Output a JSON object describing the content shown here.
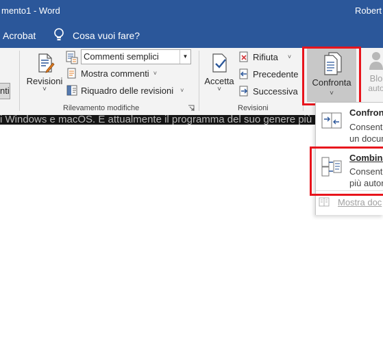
{
  "titlebar": {
    "title": "mento1 - Word",
    "user": "Robert"
  },
  "menubar": {
    "acrobat": "Acrobat",
    "tell_me": "Cosa vuoi fare?"
  },
  "ribbon": {
    "cut_button_label": "nti",
    "revisioni": {
      "label": "Revisioni",
      "caret": "˅"
    },
    "markup_combo": {
      "value": "Commenti semplici"
    },
    "mostra_commenti": {
      "label": "Mostra commenti",
      "caret": "˅"
    },
    "riquadro": {
      "label": "Riquadro delle revisioni",
      "caret": "˅"
    },
    "group_tracking_label": "Rilevamento modifiche",
    "accetta": {
      "label": "Accetta",
      "caret": "˅"
    },
    "rifiuta": {
      "label": "Rifiuta",
      "caret": "˅"
    },
    "precedente": {
      "label": "Precedente"
    },
    "successiva": {
      "label": "Successiva"
    },
    "group_revisioni_label": "Revisioni",
    "confronta": {
      "label": "Confronta",
      "caret": "˅"
    },
    "blocca": {
      "label_line1": "Blo",
      "label_line2": "auto"
    }
  },
  "document": {
    "visible_text": "i Windows e macOS. È attualmente il programma del suo genere più"
  },
  "dropdown": {
    "confronta": {
      "title": "Confronta",
      "desc_line1": "Consente",
      "desc_line2": "un docum"
    },
    "combina": {
      "title": "Combina",
      "desc_line1": "Consente",
      "desc_line2": "più autori"
    },
    "mostra_documenti": {
      "label": "Mostra doc"
    }
  },
  "colors": {
    "word_blue": "#2b579a",
    "highlight_red": "#e8141c",
    "pressed_gray": "#c8c8c8"
  }
}
